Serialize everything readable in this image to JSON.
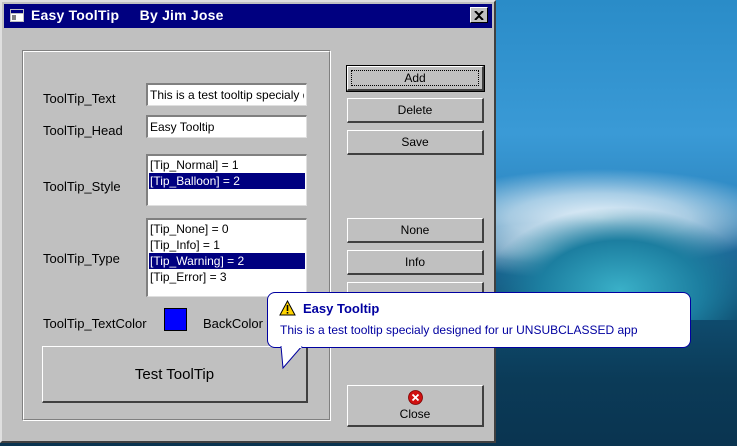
{
  "window": {
    "title": "Easy ToolTip     By Jim Jose"
  },
  "form": {
    "text_label": "ToolTip_Text",
    "text_value": "This is a test tooltip specialy designed for ur UNSUBCLASSED app",
    "head_label": "ToolTip_Head",
    "head_value": "Easy Tooltip",
    "style_label": "ToolTip_Style",
    "style_items": [
      "[Tip_Normal] = 1",
      "[Tip_Balloon] = 2"
    ],
    "style_selected": "[Tip_Balloon] = 2",
    "type_label": "ToolTip_Type",
    "type_items": [
      "[Tip_None] = 0",
      "[Tip_Info] = 1",
      "[Tip_Warning] = 2",
      "[Tip_Error] = 3"
    ],
    "type_selected": "[Tip_Warning] = 2",
    "textcolor_label": "ToolTip_TextColor",
    "backcolor_label": "BackColor",
    "textcolor_value": "#0000ff",
    "test_button": "Test ToolTip"
  },
  "buttons": {
    "add": "Add",
    "delete": "Delete",
    "save": "Save",
    "none": "None",
    "info": "Info",
    "close": "Close"
  },
  "tooltip": {
    "title": "Easy Tooltip",
    "text": "This is a test tooltip specialy designed for ur UNSUBCLASSED app",
    "icon": "warning-icon"
  },
  "colors": {
    "titlebar": "#000080",
    "selection": "#000080",
    "tooltip_text": "#0000a0"
  }
}
